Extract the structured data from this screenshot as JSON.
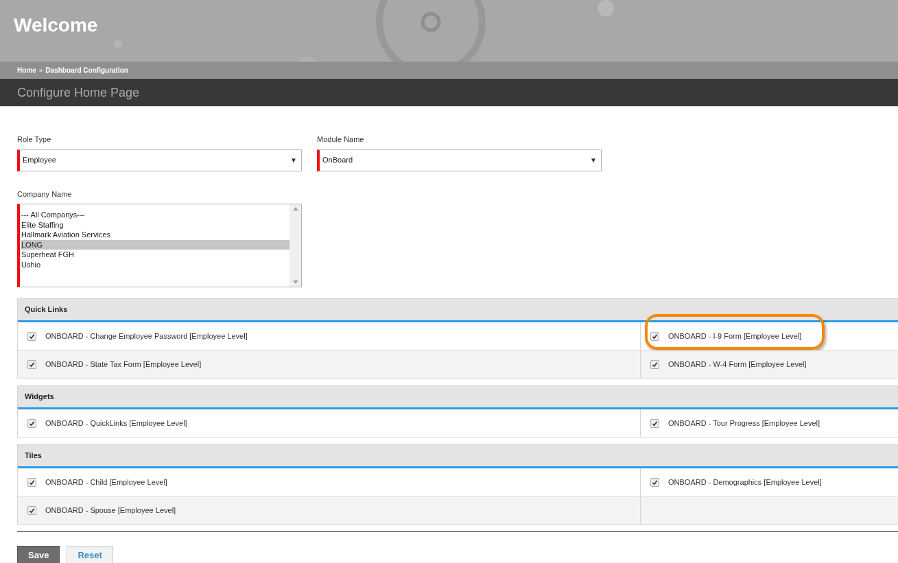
{
  "banner": {
    "title": "Welcome"
  },
  "breadcrumb": [
    {
      "label": "Home"
    },
    {
      "label": "Dashboard Configuration"
    }
  ],
  "breadcrumb_separator": "»",
  "page_title": "Configure Home Page",
  "role_type": {
    "label": "Role Type",
    "value": "Employee",
    "arrow": "▼"
  },
  "module_name": {
    "label": "Module Name",
    "value": "OnBoard",
    "arrow": "▼"
  },
  "company_name": {
    "label": "Company Name",
    "options": [
      {
        "label": "--- All Companys---",
        "selected": false
      },
      {
        "label": "Elite Staffing",
        "selected": false
      },
      {
        "label": "Hallmark Aviation Services",
        "selected": false
      },
      {
        "label": "LONG",
        "selected": true
      },
      {
        "label": "Superheat FGH",
        "selected": false
      },
      {
        "label": "Ushio",
        "selected": false
      }
    ]
  },
  "sections": [
    {
      "title": "Quick Links",
      "items": [
        {
          "label": "ONBOARD - Change Employee Password [Employee Level]",
          "checked": true,
          "highlighted": false
        },
        {
          "label": "ONBOARD - I-9 Form [Employee Level]",
          "checked": true,
          "highlighted": true
        },
        {
          "label": "ONBOARD - State Tax Form [Employee Level]",
          "checked": true,
          "highlighted": false
        },
        {
          "label": "ONBOARD - W-4 Form [Employee Level]",
          "checked": true,
          "highlighted": false
        }
      ]
    },
    {
      "title": "Widgets",
      "items": [
        {
          "label": "ONBOARD - QuickLinks [Employee Level]",
          "checked": true,
          "highlighted": false
        },
        {
          "label": "ONBOARD - Tour Progress [Employee Level]",
          "checked": true,
          "highlighted": false
        }
      ]
    },
    {
      "title": "Tiles",
      "items": [
        {
          "label": "ONBOARD - Child [Employee Level]",
          "checked": true,
          "highlighted": false
        },
        {
          "label": "ONBOARD - Demographics [Employee Level]",
          "checked": true,
          "highlighted": false
        },
        {
          "label": "ONBOARD - Spouse [Employee Level]",
          "checked": true,
          "highlighted": false
        }
      ]
    }
  ],
  "buttons": [
    {
      "label": "Save",
      "kind": "primary"
    },
    {
      "label": "Reset",
      "kind": "secondary"
    }
  ]
}
